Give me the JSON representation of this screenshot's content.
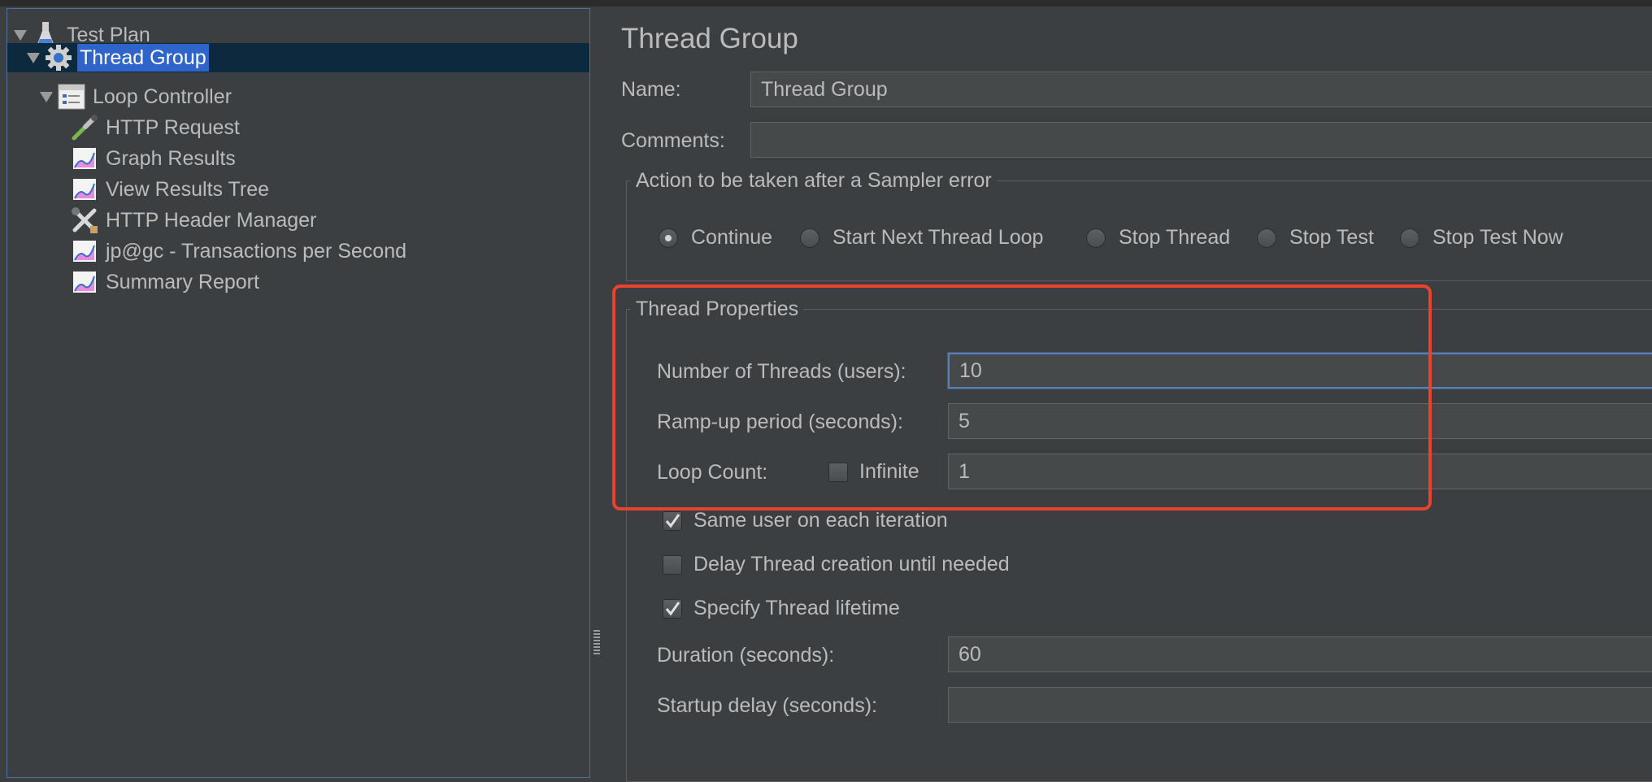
{
  "tree": {
    "items": [
      {
        "label": "Test Plan",
        "icon": "flask-icon"
      },
      {
        "label": "Thread Group",
        "icon": "gear-icon"
      },
      {
        "label": "Loop Controller",
        "icon": "loop-controller-icon"
      },
      {
        "label": "HTTP Request",
        "icon": "pipette-icon"
      },
      {
        "label": "Graph Results",
        "icon": "graph-listener-icon"
      },
      {
        "label": "View Results Tree",
        "icon": "graph-listener-icon"
      },
      {
        "label": "HTTP Header Manager",
        "icon": "tools-icon"
      },
      {
        "label": "jp@gc - Transactions per Second",
        "icon": "graph-listener-icon"
      },
      {
        "label": "Summary Report",
        "icon": "graph-listener-icon"
      }
    ]
  },
  "panel": {
    "title": "Thread Group",
    "name_label": "Name:",
    "name_value": "Thread Group",
    "comments_label": "Comments:",
    "comments_value": ""
  },
  "sampler_error": {
    "title": "Action to be taken after a Sampler error",
    "options": [
      "Continue",
      "Start Next Thread Loop",
      "Stop Thread",
      "Stop Test",
      "Stop Test Now"
    ],
    "selected": "Continue"
  },
  "thread_properties": {
    "title": "Thread Properties",
    "threads_label": "Number of Threads (users):",
    "threads_value": "10",
    "rampup_label": "Ramp-up period (seconds):",
    "rampup_value": "5",
    "loop_label": "Loop Count:",
    "infinite_label": "Infinite",
    "infinite_checked": false,
    "loop_value": "1",
    "same_user_label": "Same user on each iteration",
    "same_user_checked": true,
    "delay_label": "Delay Thread creation until needed",
    "delay_checked": false,
    "lifetime_label": "Specify Thread lifetime",
    "lifetime_checked": true,
    "duration_label": "Duration (seconds):",
    "duration_value": "60",
    "startup_label": "Startup delay (seconds):",
    "startup_value": ""
  },
  "colors": {
    "background": "#3c3f41",
    "selection": "#2f65ca",
    "highlight_box": "#e8432f",
    "focus_border": "#5a7fb3"
  }
}
